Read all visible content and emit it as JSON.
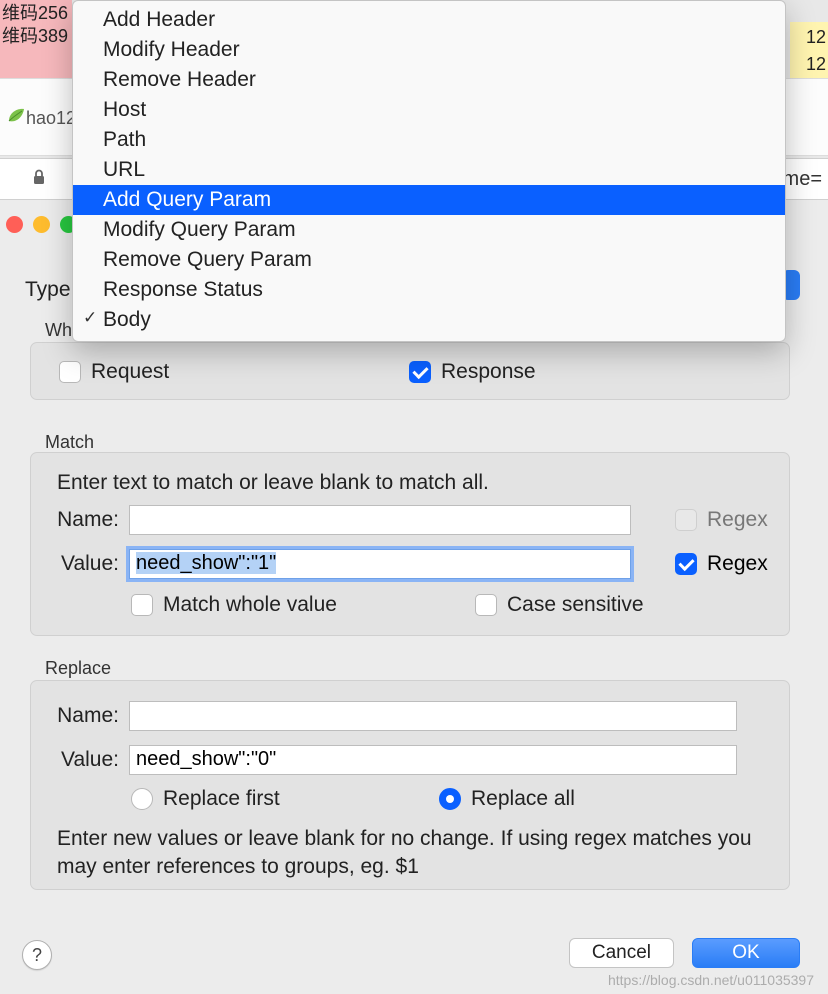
{
  "bg": {
    "pink_line1": "维码256",
    "pink_line2": "维码389",
    "yellow_line1": "12",
    "yellow_line2": "12",
    "fav_label": "hao12",
    "url_tail": "me="
  },
  "type_label": "Type:",
  "dropdown": {
    "items": [
      "Add Header",
      "Modify Header",
      "Remove Header",
      "Host",
      "Path",
      "URL",
      "Add Query Param",
      "Modify Query Param",
      "Remove Query Param",
      "Response Status",
      "Body"
    ],
    "highlighted_index": 6,
    "checked_index": 10
  },
  "where": {
    "label": "Where",
    "request": "Request",
    "response": "Response",
    "request_checked": false,
    "response_checked": true
  },
  "match": {
    "label": "Match",
    "hint": "Enter text to match or leave blank to match all.",
    "name_label": "Name:",
    "name_value": "",
    "value_label": "Value:",
    "value_value": "need_show\":\"1\"",
    "regex_label": "Regex",
    "regex_name_checked": false,
    "regex_value_checked": true,
    "whole_label": "Match whole value",
    "whole_checked": false,
    "case_label": "Case sensitive",
    "case_checked": false
  },
  "replace": {
    "label": "Replace",
    "name_label": "Name:",
    "name_value": "",
    "value_label": "Value:",
    "value_value": "need_show\":\"0\"",
    "first_label": "Replace first",
    "all_label": "Replace all",
    "selected": "all",
    "hint": "Enter new values or leave blank for no change. If using regex matches you may enter references to groups, eg. $1"
  },
  "buttons": {
    "cancel": "Cancel",
    "ok": "OK",
    "help": "?"
  },
  "watermark": "https://blog.csdn.net/u011035397"
}
